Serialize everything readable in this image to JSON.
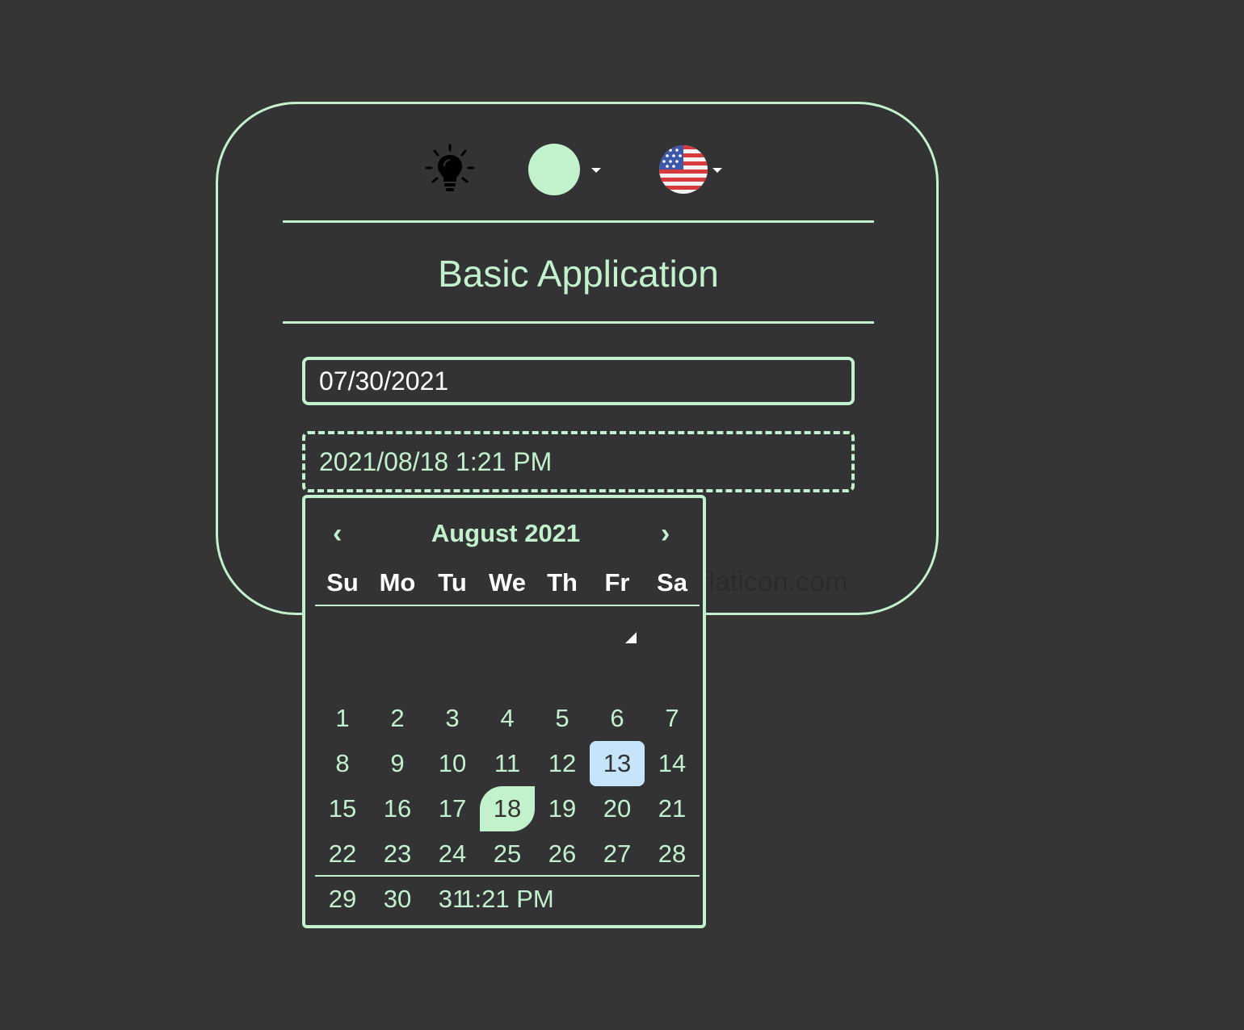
{
  "app": {
    "title": "Basic Application",
    "credit": "flaticon.com"
  },
  "toolbar": {
    "bulb_icon": "lightbulb-icon",
    "theme_color": "#c2f2cc",
    "language_flag": "us-flag-icon"
  },
  "fields": {
    "date_value": "07/30/2021",
    "datetime_value": "2021/08/18 1:21 PM"
  },
  "datepicker": {
    "month_label": "August 2021",
    "prev_label": "‹",
    "next_label": "›",
    "weekdays": [
      "Su",
      "Mo",
      "Tu",
      "We",
      "Th",
      "Fr",
      "Sa"
    ],
    "weeks": [
      [
        "",
        "",
        "",
        "",
        "",
        "",
        ""
      ],
      [
        "1",
        "2",
        "3",
        "4",
        "5",
        "6",
        "7"
      ],
      [
        "8",
        "9",
        "10",
        "11",
        "12",
        "13",
        "14"
      ],
      [
        "15",
        "16",
        "17",
        "18",
        "19",
        "20",
        "21"
      ],
      [
        "22",
        "23",
        "24",
        "25",
        "26",
        "27",
        "28"
      ],
      [
        "29",
        "30",
        "31",
        "",
        "",
        "",
        ""
      ]
    ],
    "today": "13",
    "selected": "18",
    "time_label": "1:21 PM"
  },
  "colors": {
    "accent": "#c2f2cc",
    "background": "#353634",
    "today_highlight": "#c6e5fa"
  }
}
